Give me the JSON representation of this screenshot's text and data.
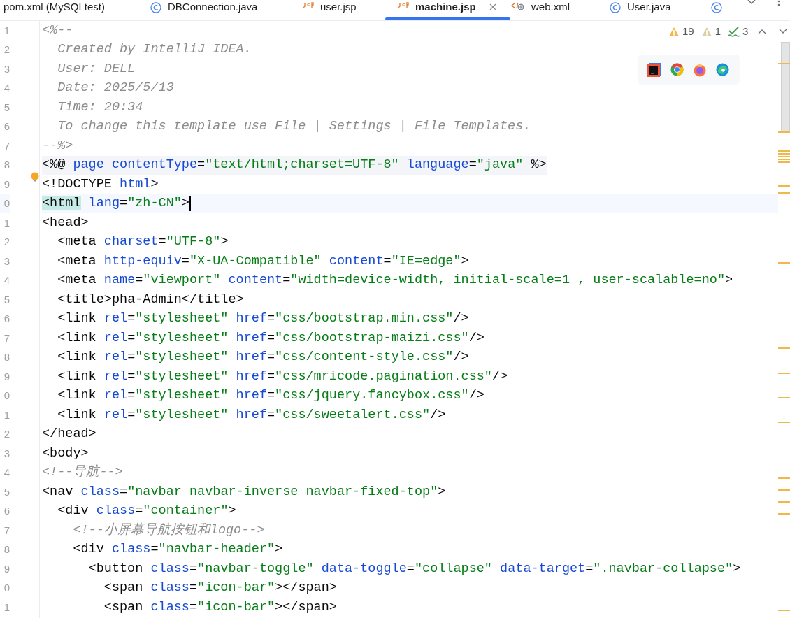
{
  "tabs": [
    {
      "label": "pom.xml (MySQLtest)",
      "kind": "plain",
      "selected": false,
      "closable": false
    },
    {
      "label": "DBConnection.java",
      "kind": "class",
      "selected": false,
      "closable": false
    },
    {
      "label": "user.jsp",
      "kind": "jsp",
      "selected": false,
      "closable": false
    },
    {
      "label": "machine.jsp",
      "kind": "jsp",
      "selected": true,
      "closable": true
    },
    {
      "label": "web.xml",
      "kind": "xml",
      "selected": false,
      "closable": false
    },
    {
      "label": "User.java",
      "kind": "class",
      "selected": false,
      "closable": false
    },
    {
      "kind": "class",
      "selected": false,
      "closable": false
    }
  ],
  "inspections": {
    "warnings": "19",
    "weak_warnings": "1",
    "typos": "3"
  },
  "lines": [
    {
      "number": "1",
      "kind": "code",
      "current": false,
      "segments": [
        {
          "kind": "comment",
          "text": "<%--"
        }
      ]
    },
    {
      "number": "2",
      "kind": "code",
      "current": false,
      "segments": [
        {
          "kind": "comment",
          "text": "  Created by IntelliJ IDEA."
        }
      ]
    },
    {
      "number": "3",
      "kind": "code",
      "current": false,
      "segments": [
        {
          "kind": "comment",
          "text": "  User: DELL"
        }
      ]
    },
    {
      "number": "4",
      "kind": "code",
      "current": false,
      "segments": [
        {
          "kind": "comment",
          "text": "  Date: 2025/5/13"
        }
      ]
    },
    {
      "number": "5",
      "kind": "code",
      "current": false,
      "segments": [
        {
          "kind": "comment",
          "text": "  Time: 20:34"
        }
      ]
    },
    {
      "number": "6",
      "kind": "code",
      "current": false,
      "segments": [
        {
          "kind": "comment",
          "text": "  To change this template use File | Settings | File Templates."
        }
      ]
    },
    {
      "number": "7",
      "kind": "code",
      "current": false,
      "segments": [
        {
          "kind": "comment",
          "text": "--%>"
        }
      ]
    },
    {
      "number": "8",
      "kind": "directive",
      "current": false,
      "segments": [
        {
          "kind": "tag",
          "text": "<%@"
        },
        {
          "kind": "attr",
          "text": " page contentType"
        },
        {
          "kind": "plain",
          "text": "="
        },
        {
          "kind": "string",
          "text": "\"text/html;charset=UTF-8\""
        },
        {
          "kind": "attr",
          "text": " language"
        },
        {
          "kind": "plain",
          "text": "="
        },
        {
          "kind": "string",
          "text": "\"java\""
        },
        {
          "kind": "tag",
          "text": " %>"
        }
      ]
    },
    {
      "number": "9",
      "kind": "code",
      "current": false,
      "segments": [
        {
          "kind": "tag",
          "text": "<!DOCTYPE"
        },
        {
          "kind": "attr",
          "text": " html"
        },
        {
          "kind": "tag",
          "text": ">"
        }
      ]
    },
    {
      "number": "0",
      "kind": "code",
      "current": true,
      "segments": [
        {
          "kind": "matched_tag",
          "text": "<html"
        },
        {
          "kind": "attr",
          "text": " lang"
        },
        {
          "kind": "plain",
          "text": "="
        },
        {
          "kind": "string",
          "text": "\"zh-CN\""
        },
        {
          "kind": "tag",
          "text": ">"
        }
      ]
    },
    {
      "number": "1",
      "kind": "code",
      "current": false,
      "segments": [
        {
          "kind": "tag",
          "text": "<head>"
        }
      ]
    },
    {
      "number": "2",
      "kind": "code",
      "current": false,
      "segments": [
        {
          "kind": "tag",
          "text": "  <meta"
        },
        {
          "kind": "attr",
          "text": " charset"
        },
        {
          "kind": "plain",
          "text": "="
        },
        {
          "kind": "string",
          "text": "\"UTF-8\""
        },
        {
          "kind": "tag",
          "text": ">"
        }
      ]
    },
    {
      "number": "3",
      "kind": "code",
      "current": false,
      "segments": [
        {
          "kind": "tag",
          "text": "  <meta"
        },
        {
          "kind": "attr",
          "text": " http-equiv"
        },
        {
          "kind": "plain",
          "text": "="
        },
        {
          "kind": "string",
          "text": "\"X-UA-Compatible\""
        },
        {
          "kind": "attr",
          "text": " content"
        },
        {
          "kind": "plain",
          "text": "="
        },
        {
          "kind": "string",
          "text": "\"IE=edge\""
        },
        {
          "kind": "tag",
          "text": ">"
        }
      ]
    },
    {
      "number": "4",
      "kind": "code",
      "current": false,
      "segments": [
        {
          "kind": "tag",
          "text": "  <meta"
        },
        {
          "kind": "attr",
          "text": " name"
        },
        {
          "kind": "plain",
          "text": "="
        },
        {
          "kind": "string",
          "text": "\"viewport\""
        },
        {
          "kind": "attr",
          "text": " content"
        },
        {
          "kind": "plain",
          "text": "="
        },
        {
          "kind": "string",
          "text": "\"width=device-width, initial-scale=1 , user-scalable=no\""
        },
        {
          "kind": "tag",
          "text": ">"
        }
      ]
    },
    {
      "number": "5",
      "kind": "code",
      "current": false,
      "segments": [
        {
          "kind": "tag",
          "text": "  <title>"
        },
        {
          "kind": "plain",
          "text": "pha-Admin"
        },
        {
          "kind": "tag",
          "text": "</title>"
        }
      ]
    },
    {
      "number": "6",
      "kind": "code",
      "current": false,
      "segments": [
        {
          "kind": "tag",
          "text": "  <link"
        },
        {
          "kind": "attr",
          "text": " rel"
        },
        {
          "kind": "plain",
          "text": "="
        },
        {
          "kind": "string",
          "text": "\"stylesheet\""
        },
        {
          "kind": "attr",
          "text": " href"
        },
        {
          "kind": "plain",
          "text": "="
        },
        {
          "kind": "string",
          "text": "\"css/bootstrap.min.css\""
        },
        {
          "kind": "tag",
          "text": "/>"
        }
      ]
    },
    {
      "number": "7",
      "kind": "code",
      "current": false,
      "segments": [
        {
          "kind": "tag",
          "text": "  <link"
        },
        {
          "kind": "attr",
          "text": " rel"
        },
        {
          "kind": "plain",
          "text": "="
        },
        {
          "kind": "string",
          "text": "\"stylesheet\""
        },
        {
          "kind": "attr",
          "text": " href"
        },
        {
          "kind": "plain",
          "text": "="
        },
        {
          "kind": "string",
          "text": "\"css/bootstrap-maizi.css\""
        },
        {
          "kind": "tag",
          "text": "/>"
        }
      ]
    },
    {
      "number": "8",
      "kind": "code",
      "current": false,
      "segments": [
        {
          "kind": "tag",
          "text": "  <link"
        },
        {
          "kind": "attr",
          "text": " rel"
        },
        {
          "kind": "plain",
          "text": "="
        },
        {
          "kind": "string",
          "text": "\"stylesheet\""
        },
        {
          "kind": "attr",
          "text": " href"
        },
        {
          "kind": "plain",
          "text": "="
        },
        {
          "kind": "string",
          "text": "\"css/content-style.css\""
        },
        {
          "kind": "tag",
          "text": "/>"
        }
      ]
    },
    {
      "number": "9",
      "kind": "code",
      "current": false,
      "segments": [
        {
          "kind": "tag",
          "text": "  <link"
        },
        {
          "kind": "attr",
          "text": " rel"
        },
        {
          "kind": "plain",
          "text": "="
        },
        {
          "kind": "string",
          "text": "\"stylesheet\""
        },
        {
          "kind": "attr",
          "text": " href"
        },
        {
          "kind": "plain",
          "text": "="
        },
        {
          "kind": "string",
          "text": "\"css/mricode.pagination.css\""
        },
        {
          "kind": "tag",
          "text": "/>"
        }
      ]
    },
    {
      "number": "0",
      "kind": "code",
      "current": false,
      "segments": [
        {
          "kind": "tag",
          "text": "  <link"
        },
        {
          "kind": "attr",
          "text": " rel"
        },
        {
          "kind": "plain",
          "text": "="
        },
        {
          "kind": "string",
          "text": "\"stylesheet\""
        },
        {
          "kind": "attr",
          "text": " href"
        },
        {
          "kind": "plain",
          "text": "="
        },
        {
          "kind": "string",
          "text": "\"css/jquery.fancybox.css\""
        },
        {
          "kind": "tag",
          "text": "/>"
        }
      ]
    },
    {
      "number": "1",
      "kind": "code",
      "current": false,
      "segments": [
        {
          "kind": "tag",
          "text": "  <link"
        },
        {
          "kind": "attr",
          "text": " rel"
        },
        {
          "kind": "plain",
          "text": "="
        },
        {
          "kind": "string",
          "text": "\"stylesheet\""
        },
        {
          "kind": "attr",
          "text": " href"
        },
        {
          "kind": "plain",
          "text": "="
        },
        {
          "kind": "string",
          "text": "\"css/sweetalert.css\""
        },
        {
          "kind": "tag",
          "text": "/>"
        }
      ]
    },
    {
      "number": "2",
      "kind": "code",
      "current": false,
      "segments": [
        {
          "kind": "tag",
          "text": "</head>"
        }
      ]
    },
    {
      "number": "3",
      "kind": "code",
      "current": false,
      "segments": [
        {
          "kind": "tag",
          "text": "<body>"
        }
      ]
    },
    {
      "number": "4",
      "kind": "code",
      "current": false,
      "segments": [
        {
          "kind": "comment",
          "text": "<!--导航-->"
        }
      ]
    },
    {
      "number": "5",
      "kind": "code",
      "current": false,
      "segments": [
        {
          "kind": "tag",
          "text": "<nav"
        },
        {
          "kind": "attr",
          "text": " class"
        },
        {
          "kind": "plain",
          "text": "="
        },
        {
          "kind": "string",
          "text": "\"navbar navbar-inverse navbar-fixed-top\""
        },
        {
          "kind": "tag",
          "text": ">"
        }
      ]
    },
    {
      "number": "6",
      "kind": "code",
      "current": false,
      "segments": [
        {
          "kind": "tag",
          "text": "  <div"
        },
        {
          "kind": "attr",
          "text": " class"
        },
        {
          "kind": "plain",
          "text": "="
        },
        {
          "kind": "string",
          "text": "\"container\""
        },
        {
          "kind": "tag",
          "text": ">"
        }
      ]
    },
    {
      "number": "7",
      "kind": "code",
      "current": false,
      "segments": [
        {
          "kind": "comment",
          "text": "    <!--小屏幕导航按钮和logo-->"
        }
      ]
    },
    {
      "number": "8",
      "kind": "code",
      "current": false,
      "segments": [
        {
          "kind": "tag",
          "text": "    <div"
        },
        {
          "kind": "attr",
          "text": " class"
        },
        {
          "kind": "plain",
          "text": "="
        },
        {
          "kind": "string",
          "text": "\"navbar-header\""
        },
        {
          "kind": "tag",
          "text": ">"
        }
      ]
    },
    {
      "number": "9",
      "kind": "code",
      "current": false,
      "segments": [
        {
          "kind": "tag",
          "text": "      <button"
        },
        {
          "kind": "attr",
          "text": " class"
        },
        {
          "kind": "plain",
          "text": "="
        },
        {
          "kind": "string",
          "text": "\"navbar-toggle\""
        },
        {
          "kind": "attr",
          "text": " data-toggle"
        },
        {
          "kind": "plain",
          "text": "="
        },
        {
          "kind": "string",
          "text": "\"collapse\""
        },
        {
          "kind": "attr",
          "text": " data-target"
        },
        {
          "kind": "plain",
          "text": "="
        },
        {
          "kind": "string",
          "text": "\".navbar-collapse\""
        },
        {
          "kind": "tag",
          "text": ">"
        }
      ]
    },
    {
      "number": "0",
      "kind": "code",
      "current": false,
      "segments": [
        {
          "kind": "tag",
          "text": "        <span"
        },
        {
          "kind": "attr",
          "text": " class"
        },
        {
          "kind": "plain",
          "text": "="
        },
        {
          "kind": "string",
          "text": "\"icon-bar\""
        },
        {
          "kind": "tag",
          "text": "></span>"
        }
      ]
    },
    {
      "number": "1",
      "kind": "code",
      "current": false,
      "segments": [
        {
          "kind": "tag",
          "text": "        <span"
        },
        {
          "kind": "attr",
          "text": " class"
        },
        {
          "kind": "plain",
          "text": "="
        },
        {
          "kind": "string",
          "text": "\"icon-bar\""
        },
        {
          "kind": "tag",
          "text": "></span>"
        }
      ]
    }
  ]
}
